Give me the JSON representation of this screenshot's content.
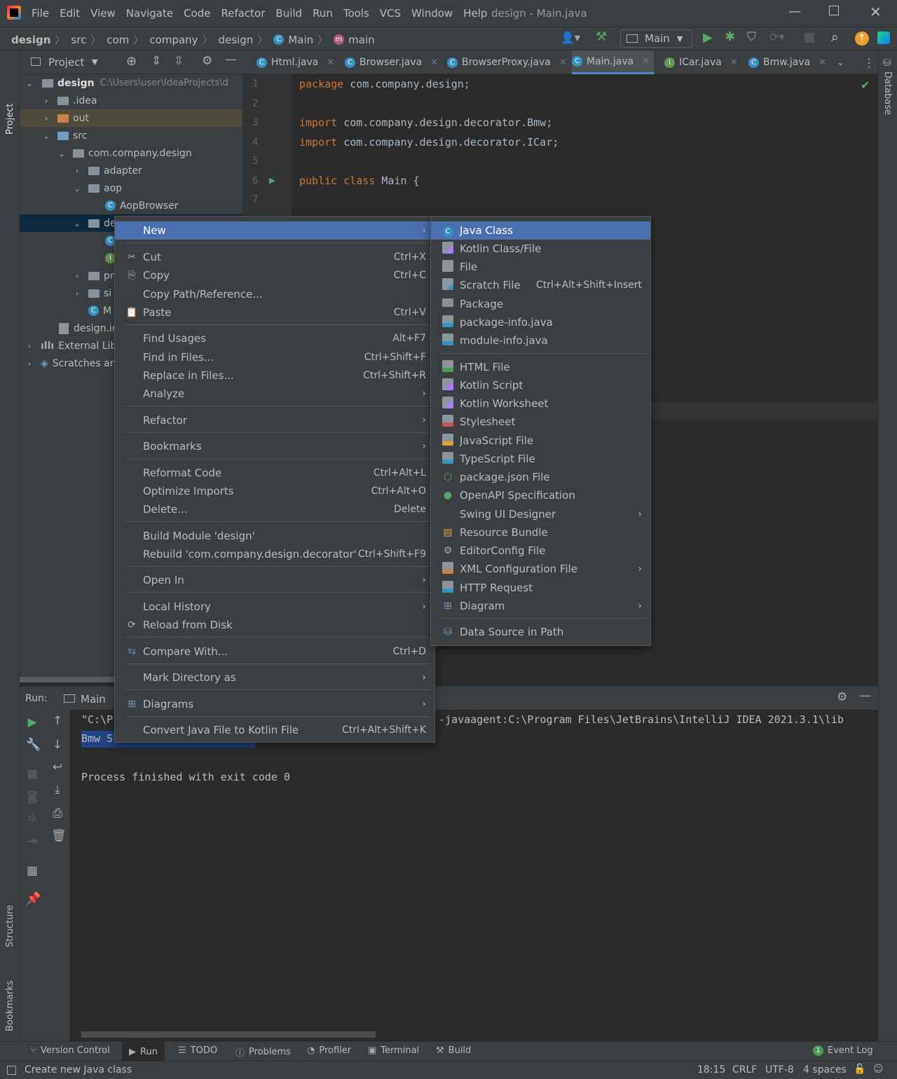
{
  "window": {
    "title": "design - Main.java",
    "menu": [
      "File",
      "Edit",
      "View",
      "Navigate",
      "Code",
      "Refactor",
      "Build",
      "Run",
      "Tools",
      "VCS",
      "Window",
      "Help"
    ]
  },
  "breadcrumb": [
    "design",
    "src",
    "com",
    "company",
    "design",
    "Main",
    "main"
  ],
  "run_config": "Main",
  "project": {
    "header": "Project",
    "root_name": "design",
    "root_path": "C:\\Users\\user\\IdeaProjects\\d",
    "nodes": [
      ".idea",
      "out",
      "src",
      "com.company.design",
      "adapter",
      "aop",
      "AopBrowser",
      "de",
      "",
      "",
      "pr",
      "si",
      "M",
      "design.in",
      "External Libr",
      "Scratches ar"
    ]
  },
  "tabs": [
    "Html.java",
    "Browser.java",
    "BrowserProxy.java",
    "Main.java",
    "ICar.java",
    "Bmw.java"
  ],
  "code": {
    "line_numbers": [
      "1",
      "2",
      "3",
      "4",
      "5",
      "6",
      "7"
    ],
    "l1_kw": "package",
    "l1_rest": " com.company.design;",
    "l3_kw": "import",
    "l3_rest": " com.company.design.decorator.Bmw;",
    "l4_kw": "import",
    "l4_rest": " com.company.design.decorator.ICar;",
    "l6_kw": "public class",
    "l6_rest": " Main {"
  },
  "sidebars": {
    "left_top": "Project",
    "left_mid": "Structure",
    "left_bottom": "Bookmarks",
    "right": "Database"
  },
  "run": {
    "label": "Run:",
    "tab": "Main",
    "line1_a": "\"C:\\P",
    "line1_b": "-javaagent:C:\\Program Files\\JetBrains\\IntelliJ IDEA 2021.3.1\\lib",
    "line2": "Bmw S",
    "line3": "Process finished with exit code 0"
  },
  "context_menu": {
    "new": "New",
    "cut": "Cut",
    "cut_sc": "Ctrl+X",
    "copy": "Copy",
    "copy_sc": "Ctrl+C",
    "copy_path": "Copy Path/Reference...",
    "paste": "Paste",
    "paste_sc": "Ctrl+V",
    "find_usages": "Find Usages",
    "find_usages_sc": "Alt+F7",
    "find_in_files": "Find in Files...",
    "find_in_files_sc": "Ctrl+Shift+F",
    "replace_in_files": "Replace in Files...",
    "replace_in_files_sc": "Ctrl+Shift+R",
    "analyze": "Analyze",
    "refactor": "Refactor",
    "bookmarks": "Bookmarks",
    "reformat": "Reformat Code",
    "reformat_sc": "Ctrl+Alt+L",
    "optimize": "Optimize Imports",
    "optimize_sc": "Ctrl+Alt+O",
    "delete": "Delete...",
    "delete_sc": "Delete",
    "build_module": "Build Module 'design'",
    "rebuild": "Rebuild 'com.company.design.decorator'",
    "rebuild_sc": "Ctrl+Shift+F9",
    "open_in": "Open In",
    "local_history": "Local History",
    "reload": "Reload from Disk",
    "compare": "Compare With...",
    "compare_sc": "Ctrl+D",
    "mark_dir": "Mark Directory as",
    "diagrams": "Diagrams",
    "convert": "Convert Java File to Kotlin File",
    "convert_sc": "Ctrl+Alt+Shift+K"
  },
  "new_submenu": {
    "java_class": "Java Class",
    "kotlin_class": "Kotlin Class/File",
    "file": "File",
    "scratch": "Scratch File",
    "scratch_sc": "Ctrl+Alt+Shift+Insert",
    "package": "Package",
    "package_info": "package-info.java",
    "module_info": "module-info.java",
    "html": "HTML File",
    "kotlin_script": "Kotlin Script",
    "kotlin_worksheet": "Kotlin Worksheet",
    "stylesheet": "Stylesheet",
    "javascript": "JavaScript File",
    "typescript": "TypeScript File",
    "package_json": "package.json File",
    "openapi": "OpenAPI Specification",
    "swing": "Swing UI Designer",
    "resource_bundle": "Resource Bundle",
    "editorconfig": "EditorConfig File",
    "xml_config": "XML Configuration File",
    "http_request": "HTTP Request",
    "diagram": "Diagram",
    "data_source": "Data Source in Path"
  },
  "bottom_tools": [
    "Version Control",
    "Run",
    "TODO",
    "Problems",
    "Profiler",
    "Terminal",
    "Build"
  ],
  "event_log": {
    "count": "1",
    "label": "Event Log"
  },
  "status": {
    "message": "Create new Java class",
    "position": "18:15",
    "line_sep": "CRLF",
    "encoding": "UTF-8",
    "indent": "4 spaces"
  },
  "colors": {
    "selection": "#4b6eaf",
    "keyword": "#cc7832",
    "bg": "#2b2b2b",
    "panel": "#3c3f41"
  }
}
